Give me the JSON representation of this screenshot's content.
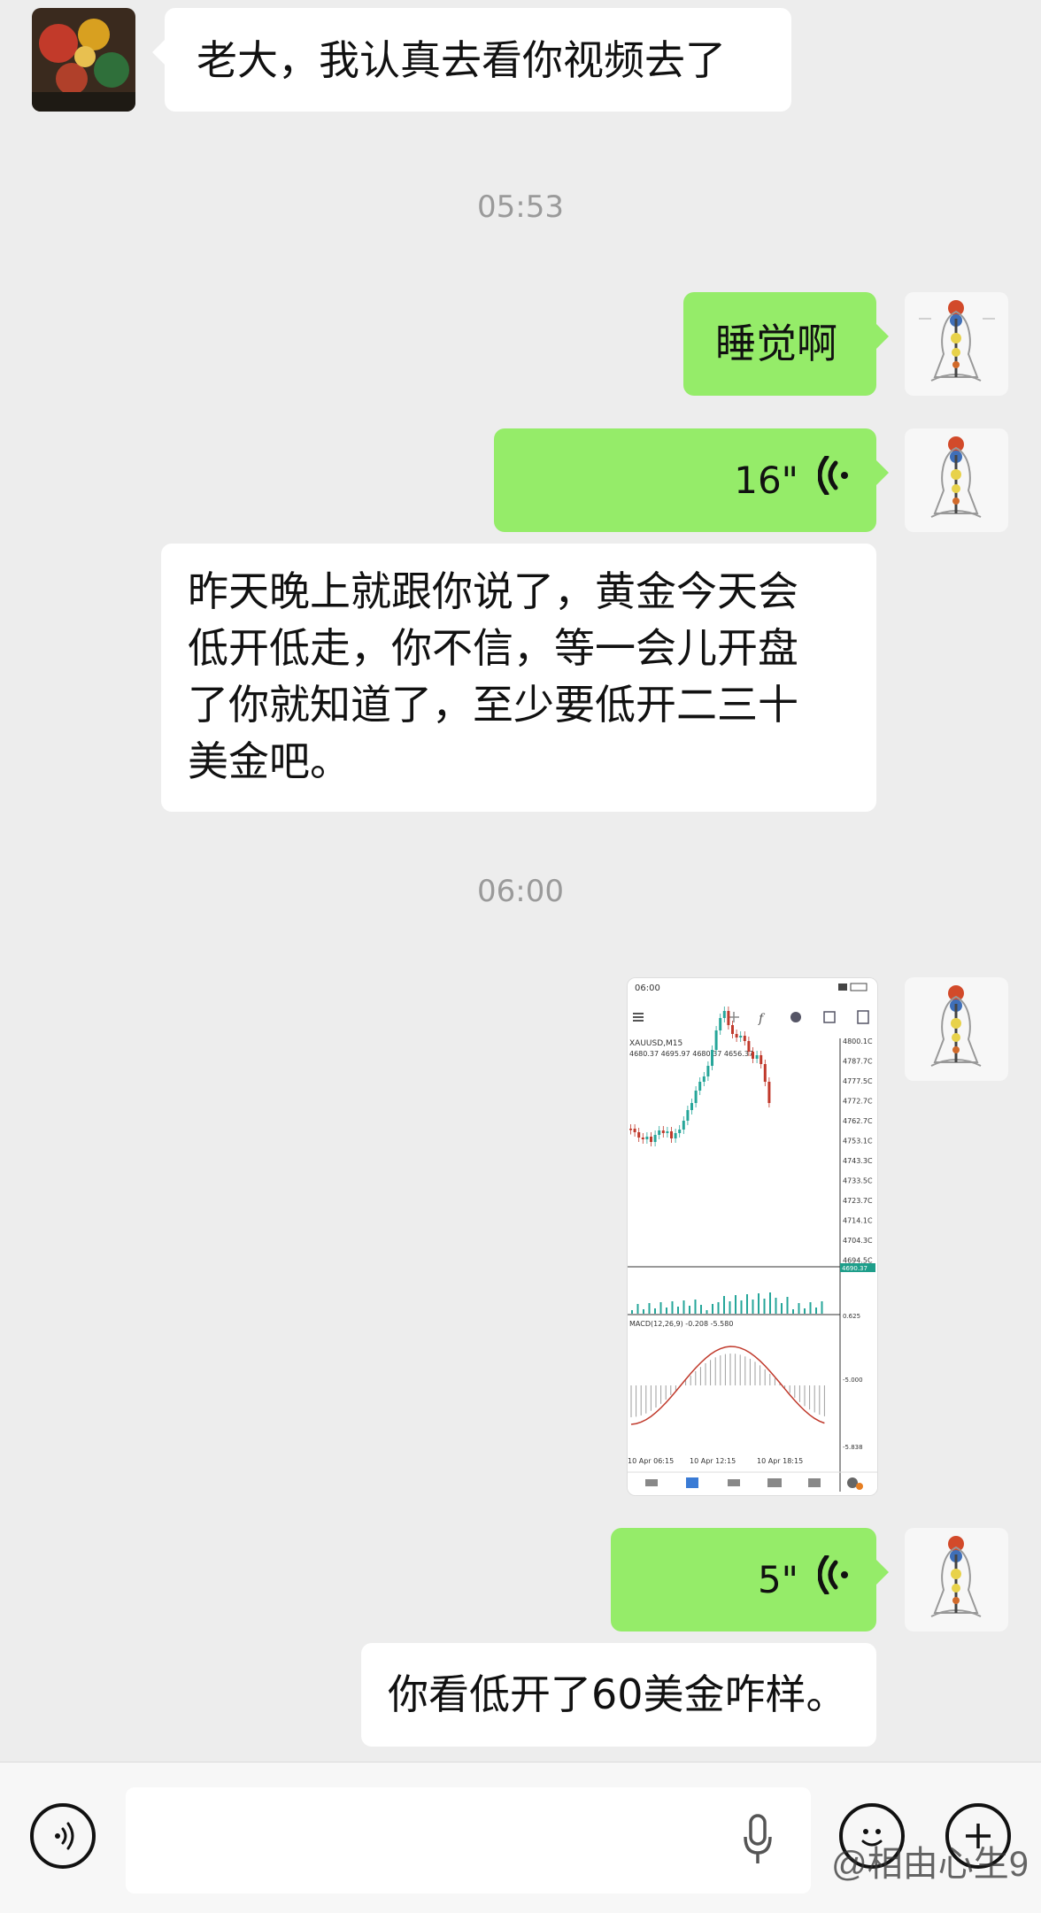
{
  "messages": {
    "m1": {
      "text": "老大，我认真去看你视频去了"
    },
    "t1": {
      "text": "05:53"
    },
    "m2": {
      "text": "睡觉啊"
    },
    "m3": {
      "duration": "16\""
    },
    "m4": {
      "line1": "昨天晚上就跟你说了，黄金今天会",
      "line2": "低开低走，你不信，等一会儿开盘",
      "line3": "了你就知道了，至少要低开二三十",
      "line4": "美金吧。"
    },
    "t2": {
      "text": "06:00"
    },
    "m5": {
      "status_time": "06:00",
      "symbol": "XAUUSD,M15",
      "ohlc": "4680.37 4695.97 4680.37 4656.37",
      "macd_label": "MACD(12,26,9) -0.208 -5.580",
      "price_ticks": [
        "4800.1C",
        "4787.7C",
        "4777.5C",
        "4772.7C",
        "4762.7C",
        "4753.1C",
        "4743.3C",
        "4733.5C",
        "4723.7C",
        "4714.1C",
        "4704.3C",
        "4694.5C"
      ],
      "current_price": "4690.37",
      "macd_ticks": [
        "0.625",
        "-5.000",
        "-5.838"
      ],
      "time_ticks": [
        "10 Apr 06:15",
        "10 Apr 12:15",
        "10 Apr 18:15"
      ]
    },
    "m6": {
      "duration": "5\""
    },
    "m7": {
      "text": "你看低开了60美金咋样。"
    }
  },
  "watermark": "@相由心生9",
  "colors": {
    "green_bubble": "#95ec69",
    "background": "#ededed"
  }
}
